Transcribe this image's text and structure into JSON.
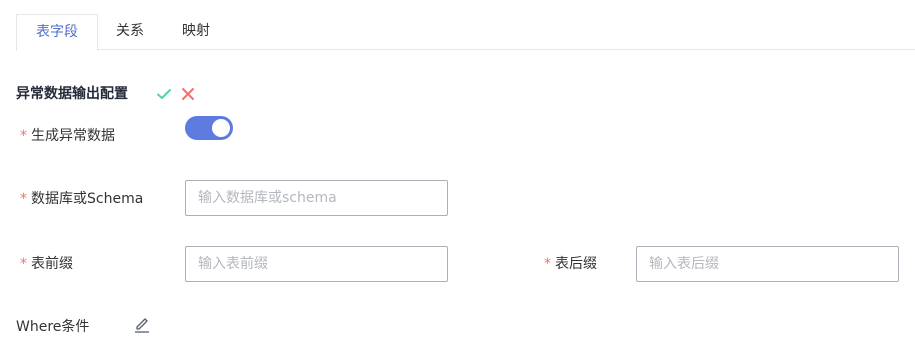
{
  "tabs": [
    {
      "label": "表字段",
      "active": true
    },
    {
      "label": "关系",
      "active": false
    },
    {
      "label": "映射",
      "active": false
    }
  ],
  "section": {
    "title": "异常数据输出配置",
    "confirm_icon": "check-icon",
    "cancel_icon": "close-icon"
  },
  "form": {
    "required_mark": "*",
    "generate_error_data": {
      "label": "生成异常数据",
      "enabled": true
    },
    "schema": {
      "label": "数据库或Schema",
      "placeholder": "输入数据库或schema",
      "value": ""
    },
    "table_prefix": {
      "label": "表前缀",
      "placeholder": "输入表前缀",
      "value": ""
    },
    "table_suffix": {
      "label": "表后缀",
      "placeholder": "输入表后缀",
      "value": ""
    },
    "where": {
      "label": "Where条件",
      "icon": "edit-icon"
    }
  },
  "colors": {
    "accent": "#5e7ce0",
    "tab_active_text": "#526ecc",
    "required": "#f66f6a",
    "confirm": "#50d4ab",
    "cancel": "#f66f6a"
  }
}
